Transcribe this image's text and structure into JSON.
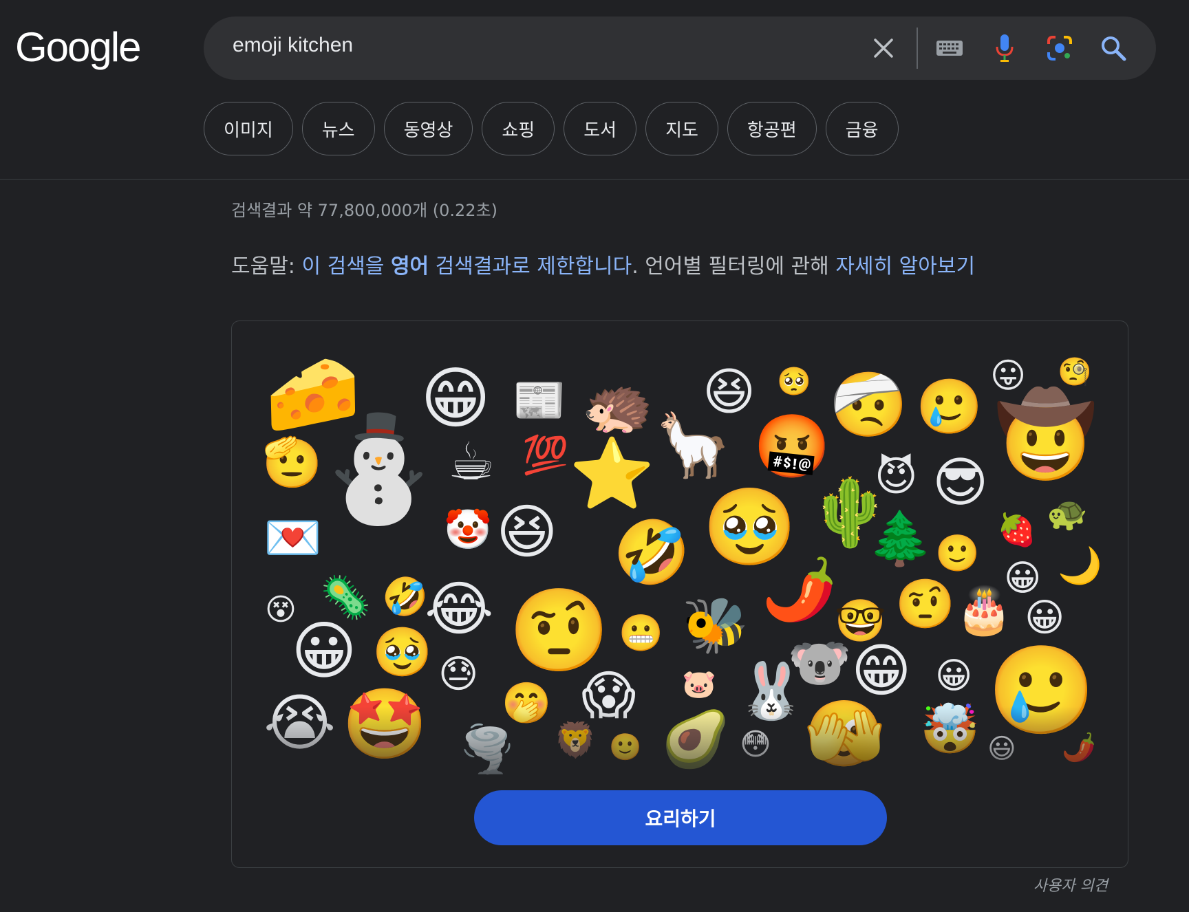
{
  "logo": {
    "text": "Google"
  },
  "search": {
    "query": "emoji kitchen"
  },
  "icons": {
    "clear": "close-icon",
    "keyboard": "keyboard-icon",
    "voice": "microphone-icon",
    "lens": "lens-camera-icon",
    "search": "search-icon"
  },
  "filters": [
    "이미지",
    "뉴스",
    "동영상",
    "쇼핑",
    "도서",
    "지도",
    "항공편",
    "금융"
  ],
  "results": {
    "stats": "검색결과 약 77,800,000개 (0.22초)"
  },
  "help": {
    "prefix": "도움말: ",
    "link1_a": "이 검색을 ",
    "link1_bold": "영어",
    "link1_b": " 검색결과로 제한합니다",
    "middle": ". 언어별 필터링에 관해 ",
    "link2": "자세히 알아보기"
  },
  "emoji_kitchen": {
    "emojis": [
      "🧀",
      "😁",
      "📰",
      "🦔",
      "😆",
      "🥺",
      "🤕",
      "🥲",
      "😛",
      "🧐",
      "🫡",
      "⛄",
      "☕",
      "💯",
      "⭐",
      "🦙",
      "🤬",
      "😈",
      "😎",
      "🤠",
      "💌",
      "🤡",
      "😆",
      "🤣",
      "🥹",
      "🌵",
      "🌲",
      "🙂",
      "🍓",
      "🐢",
      "😀",
      "🌙",
      "😵",
      "🦠",
      "🤣",
      "😂",
      "🤨",
      "😬",
      "🐝",
      "🌶️",
      "🤓",
      "🤨",
      "🎂",
      "😀",
      "😀",
      "🥹",
      "😓",
      "🐨",
      "😁",
      "😀",
      "🥲",
      "😭",
      "🤩",
      "🤭",
      "😱",
      "🐷",
      "🐰",
      "🦁",
      "🙂",
      "🥑",
      "😳",
      "🫣",
      "🤯",
      "😃",
      "🌪️",
      "🌶️"
    ],
    "button_label": "요리하기"
  },
  "feedback": "사용자 의견",
  "colors": {
    "background": "#202124",
    "search_bar": "#303134",
    "link": "#8ab4f8",
    "button": "#2456d3"
  }
}
